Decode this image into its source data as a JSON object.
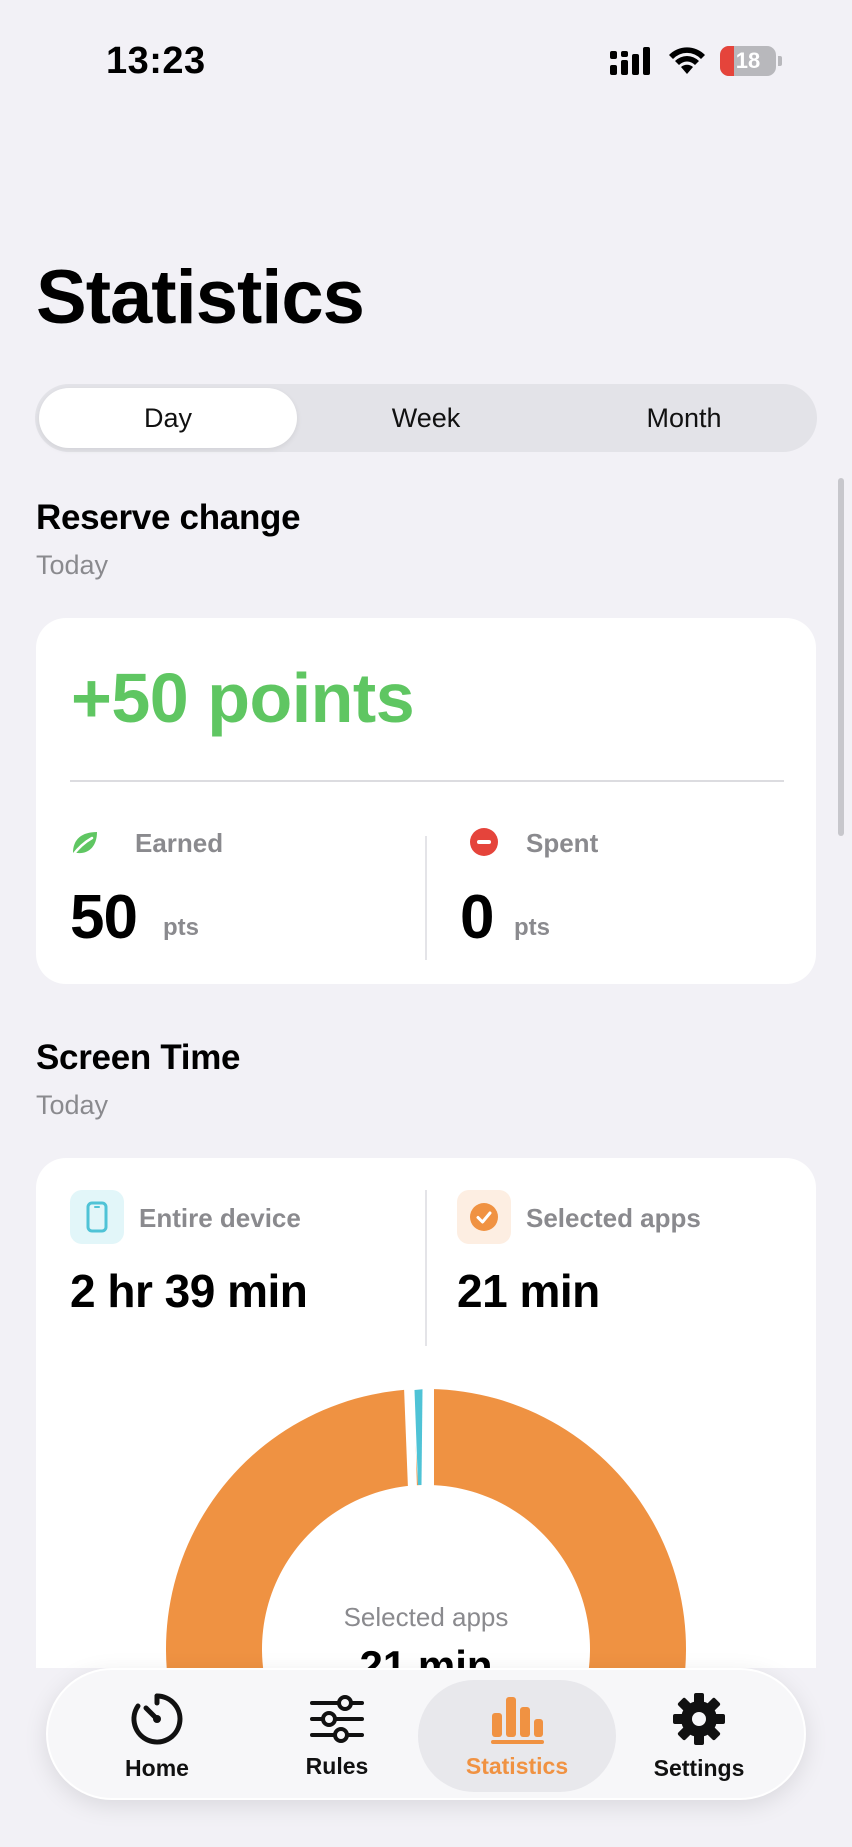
{
  "status_bar": {
    "time": "13:23",
    "battery": "18"
  },
  "page": {
    "title": "Statistics"
  },
  "segments": [
    {
      "label": "Day",
      "active": true
    },
    {
      "label": "Week",
      "active": false
    },
    {
      "label": "Month",
      "active": false
    }
  ],
  "reserve": {
    "title": "Reserve change",
    "subtitle": "Today",
    "total": "+50 points",
    "earned_label": "Earned",
    "earned_value": "50",
    "earned_unit": "pts",
    "spent_label": "Spent",
    "spent_value": "0",
    "spent_unit": "pts"
  },
  "screen_time": {
    "title": "Screen Time",
    "subtitle": "Today",
    "device_label": "Entire device",
    "device_value": "2 hr 39 min",
    "apps_label": "Selected apps",
    "apps_value": "21 min",
    "donut_center_label": "Selected apps",
    "donut_center_value": "21 min"
  },
  "tabs": [
    {
      "label": "Home",
      "icon": "gauge-icon"
    },
    {
      "label": "Rules",
      "icon": "sliders-icon"
    },
    {
      "label": "Statistics",
      "icon": "bar-chart-icon",
      "active": true
    },
    {
      "label": "Settings",
      "icon": "gear-icon"
    }
  ],
  "colors": {
    "accent": "#f09242",
    "positive": "#5fc662",
    "negative": "#e5443b",
    "teal": "#4fc3d6"
  }
}
